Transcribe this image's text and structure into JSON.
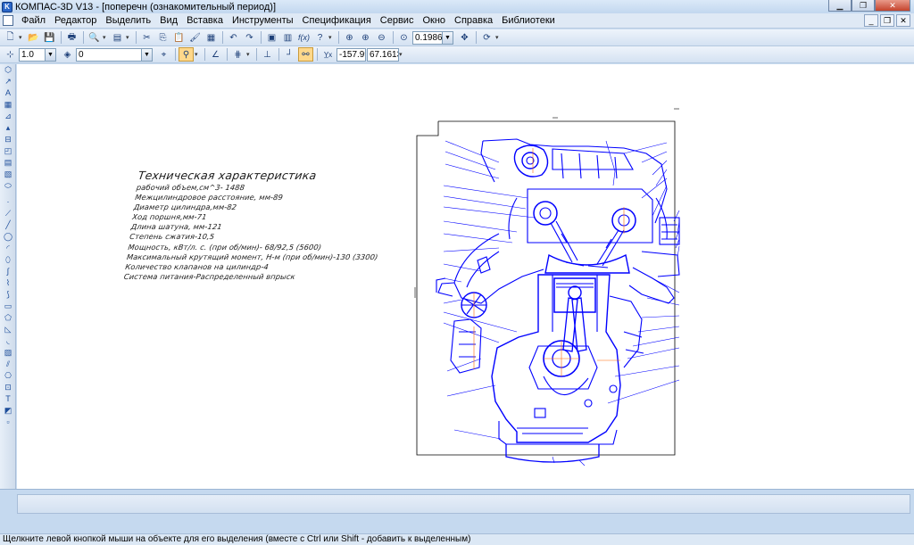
{
  "window": {
    "title": "КОМПАС-3D V13 - [поперечн (ознакомительный период)]"
  },
  "menu": {
    "items": [
      "Файл",
      "Редактор",
      "Выделить",
      "Вид",
      "Вставка",
      "Инструменты",
      "Спецификация",
      "Сервис",
      "Окно",
      "Справка",
      "Библиотеки"
    ]
  },
  "toolbar": {
    "zoom_value": "0.1986"
  },
  "toolbar2": {
    "line_scale": "1.0",
    "layer": "0",
    "coord_x": "-157.99",
    "coord_y": "67.1613"
  },
  "drawing": {
    "spec_title": "Техническая характеристика",
    "spec_lines": [
      "рабочий объем,см^3- 1488",
      "Межцилиндровое расстояние, мм-89",
      "Диаметр цилиндра,мм-82",
      "Ход поршня,мм-71",
      "Длина шатуна, мм-121",
      "Степень сжатия-10,5",
      "Мощность, кВт/л. с. (при об/мин)- 68/92,5 (5600)",
      "Максимальный крутящий момент, Н-м (при об/мин)-130 (3300)",
      "Количество клапанов на цилиндр-4",
      "Система питания-Распределенный впрыск"
    ],
    "line_color": "#0000ff",
    "frame_color": "#000000"
  },
  "status": {
    "text": "Щелкните левой кнопкой мыши на объекте для его выделения (вместе с Ctrl или Shift - добавить к выделенным)"
  }
}
